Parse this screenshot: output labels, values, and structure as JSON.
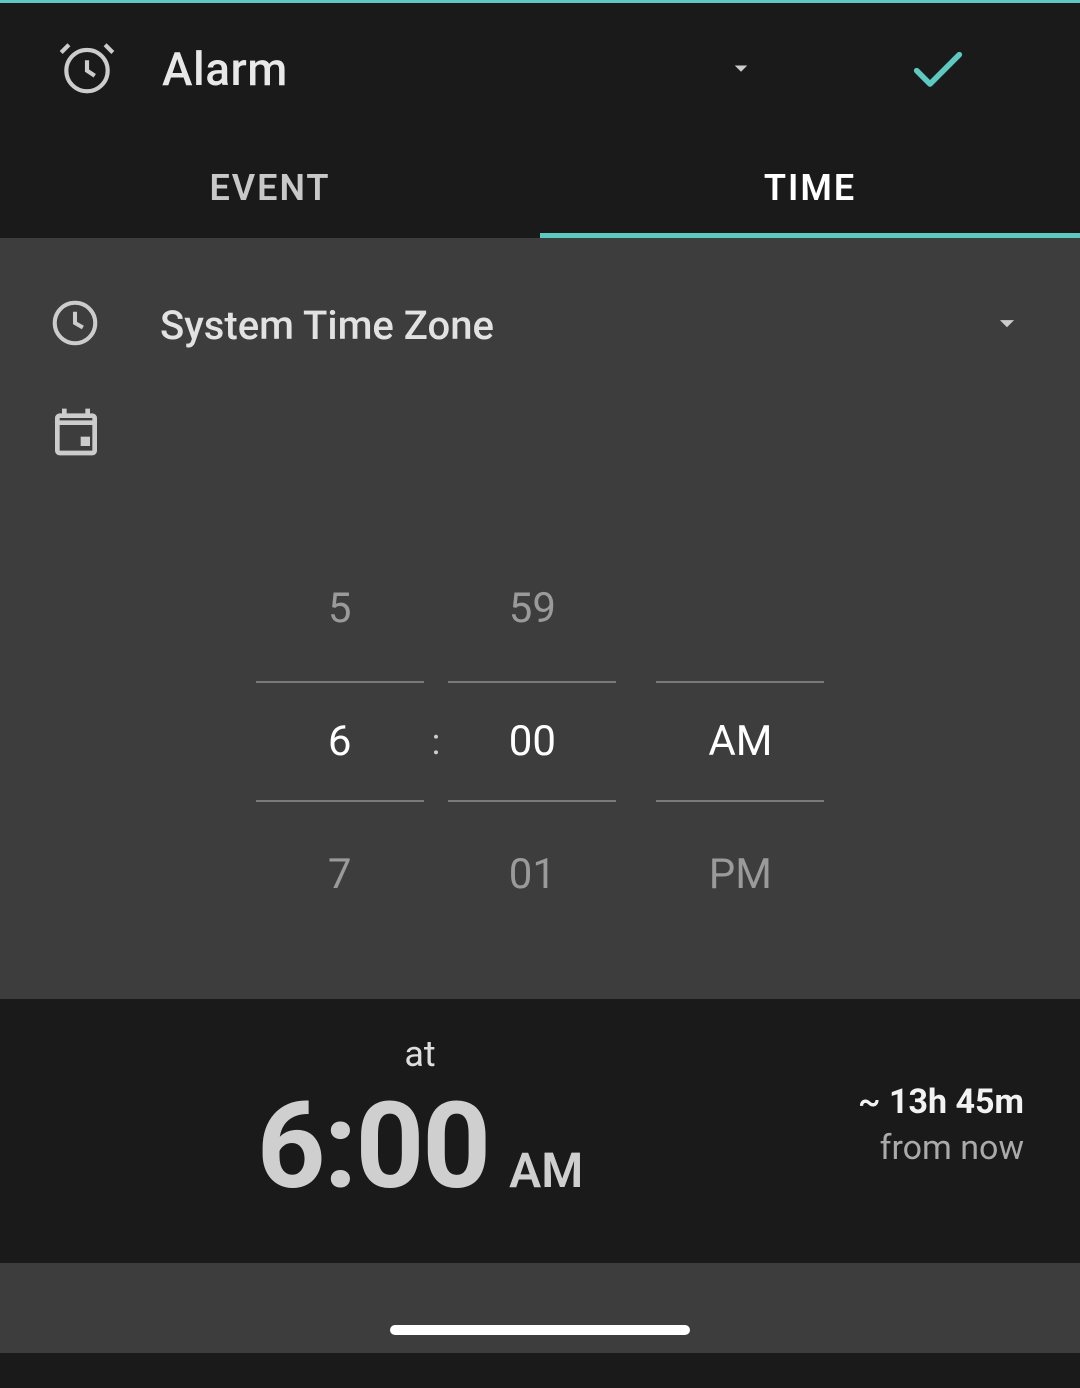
{
  "header": {
    "title": "Alarm"
  },
  "tabs": {
    "event_label": "EVENT",
    "time_label": "TIME"
  },
  "timezone": {
    "label": "System Time Zone"
  },
  "time_picker": {
    "hour_prev": "5",
    "hour_selected": "6",
    "hour_next": "7",
    "minute_prev": "59",
    "minute_selected": "00",
    "minute_next": "01",
    "ampm_selected": "AM",
    "ampm_next": "PM",
    "separator": ":"
  },
  "summary": {
    "at_label": "at",
    "time_display": "6:00",
    "ampm_display": "AM",
    "relative_prefix": "~ ",
    "relative_value": "13h 45m",
    "relative_suffix": "from now"
  }
}
